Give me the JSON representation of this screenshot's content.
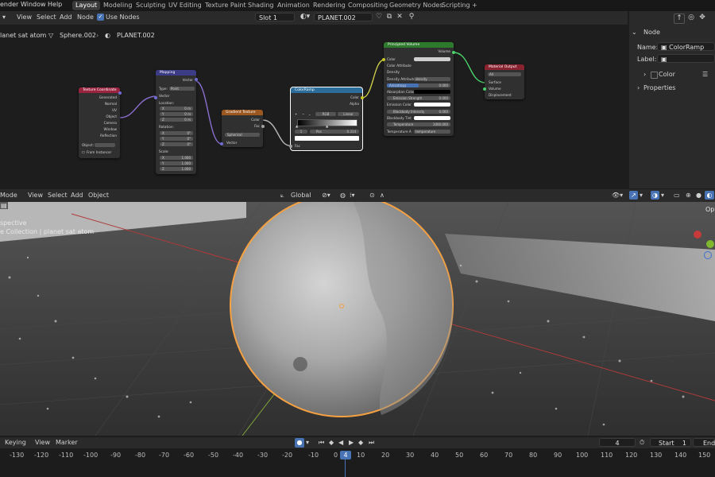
{
  "menu": [
    "ender",
    "Window",
    "Help"
  ],
  "workspaces": [
    "Layout",
    "Modeling",
    "Sculpting",
    "UV Editing",
    "Texture Paint",
    "Shading",
    "Animation",
    "Rendering",
    "Compositing",
    "Geometry Nodes",
    "Scripting"
  ],
  "workspace_add": "+",
  "node_header": {
    "menus": [
      "View",
      "Select",
      "Add",
      "Node"
    ],
    "use_nodes_label": "Use Nodes",
    "use_nodes_checked": true,
    "slot": "Slot 1",
    "material": "PLANET.002"
  },
  "breadcrumb": [
    "lanet sat atom",
    "Sphere.002",
    "PLANET.002"
  ],
  "nodes": {
    "texcoord": {
      "title": "Texture Coordinate",
      "outputs": [
        "Generated",
        "Normal",
        "UV",
        "Object",
        "Camera",
        "Window",
        "Reflection"
      ],
      "object_label": "Object:",
      "from_instancer": "From Instancer",
      "color": "#9a2340"
    },
    "mapping": {
      "title": "Mapping",
      "out": "Vector",
      "type_label": "Type:",
      "type_value": "Point",
      "in_vector": "Vector",
      "location": "Location:",
      "rotation": "Rotation:",
      "scale": "Scale:",
      "axes": [
        "X",
        "Y",
        "Z"
      ],
      "loc_values": [
        "0 m",
        "0 m",
        "0 m"
      ],
      "rot_values": [
        "0°",
        "0°",
        "0°"
      ],
      "scale_values": [
        "1.000",
        "1.000",
        "1.000"
      ],
      "color": "#3b3b86"
    },
    "gradient": {
      "title": "Gradient Texture",
      "outputs": [
        "Color",
        "Fac"
      ],
      "type_value": "Spherical",
      "in_vector": "Vector",
      "color": "#9a5720"
    },
    "colorramp": {
      "title": "ColorRamp",
      "outputs": [
        "Color",
        "Alpha"
      ],
      "mode": "RGB",
      "interp": "Linear",
      "index": "1",
      "pos_label": "Pos",
      "pos_value": "0.314",
      "in_fac": "Fac",
      "color": "#2c6e9b"
    },
    "volume": {
      "title": "Principled Volume",
      "out": "Volume",
      "rows": [
        "Color",
        "Color Attribute",
        "Density",
        "Density Attribute",
        "Anisotropy",
        "Absorption Color",
        "Emission Strength",
        "Emission Color",
        "Blackbody Intensity",
        "Blackbody Tint",
        "Temperature",
        "Temperature A"
      ],
      "density_attr": "density",
      "anisotropy": "0.000",
      "emission_strength": "0.000",
      "blackbody_intensity": "0.000",
      "temperature": "1000.000",
      "temp_attr": "temperature",
      "color": "#2d7a2d"
    },
    "output": {
      "title": "Material Output",
      "target": "All",
      "inputs": [
        "Surface",
        "Volume",
        "Displacement"
      ],
      "color": "#8a2330"
    }
  },
  "right_panel": {
    "node_section": "Node",
    "name_label": "Name:",
    "name_value": "ColorRamp",
    "label_label": "Label:",
    "color_label": "Color",
    "properties_label": "Properties"
  },
  "viewport_header": {
    "mode": "Mode",
    "menus": [
      "View",
      "Select",
      "Add",
      "Object"
    ],
    "orientation": "Global"
  },
  "viewport": {
    "view_name": "spective",
    "collection": "e Collection | planet sat atom",
    "options_label": "Op"
  },
  "timeline": {
    "keying": "Keying",
    "menus": [
      "View",
      "Marker"
    ],
    "current_frame": "4",
    "start_label": "Start",
    "start_value": "1",
    "end_label": "End",
    "ruler": [
      "-130",
      "-120",
      "-110",
      "-100",
      "-90",
      "-80",
      "-70",
      "-60",
      "-50",
      "-40",
      "-30",
      "-20",
      "-10",
      "0",
      "4",
      "10",
      "20",
      "30",
      "40",
      "50",
      "60",
      "70",
      "80",
      "90",
      "100",
      "110",
      "120",
      "130",
      "140",
      "150"
    ]
  },
  "colors": {
    "accent": "#4772b3",
    "selection_orange": "#f5a142",
    "bg": "#1d1d1d"
  }
}
